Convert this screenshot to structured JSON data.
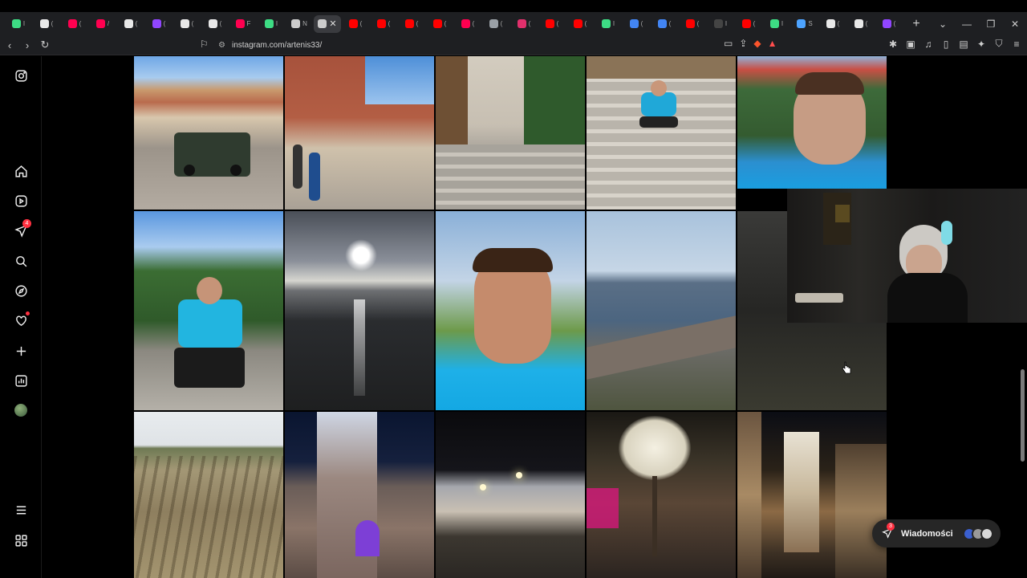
{
  "browser": {
    "tabs": [
      {
        "color": "#3ddc84",
        "letter": "I"
      },
      {
        "color": "#e8e8e8",
        "letter": "("
      },
      {
        "color": "#ff0050",
        "letter": "("
      },
      {
        "color": "#ff0050",
        "letter": "/"
      },
      {
        "color": "#e8e8e8",
        "letter": "("
      },
      {
        "color": "#9146ff",
        "letter": "("
      },
      {
        "color": "#e8e8e8",
        "letter": "("
      },
      {
        "color": "#e8e8e8",
        "letter": "("
      },
      {
        "color": "#ff0050",
        "letter": "F"
      },
      {
        "color": "#3ddc84",
        "letter": "I"
      },
      {
        "color": "#cccccc",
        "letter": "N"
      },
      {
        "color": "#cccccc",
        "letter": "(",
        "active": true
      },
      {
        "color": "#ff0000",
        "letter": "("
      },
      {
        "color": "#ff0000",
        "letter": "("
      },
      {
        "color": "#ff0000",
        "letter": "("
      },
      {
        "color": "#ff0000",
        "letter": "("
      },
      {
        "color": "#ff0050",
        "letter": "("
      },
      {
        "color": "#9aa0a6",
        "letter": "("
      },
      {
        "color": "#e1306c",
        "letter": "("
      },
      {
        "color": "#ff0000",
        "letter": "("
      },
      {
        "color": "#ff0000",
        "letter": "("
      },
      {
        "color": "#3ddc84",
        "letter": "I"
      },
      {
        "color": "#4285f4",
        "letter": "("
      },
      {
        "color": "#4285f4",
        "letter": "("
      },
      {
        "color": "#ff0000",
        "letter": "("
      },
      {
        "color": "#444444",
        "letter": "I"
      },
      {
        "color": "#ff0000",
        "letter": "("
      },
      {
        "color": "#3ddc84",
        "letter": "I"
      },
      {
        "color": "#4da3ff",
        "letter": "S"
      },
      {
        "color": "#e8e8e8",
        "letter": "("
      },
      {
        "color": "#e8e8e8",
        "letter": "("
      },
      {
        "color": "#9146ff",
        "letter": "("
      }
    ],
    "new_tab": "+",
    "url": "instagram.com/artenis33/"
  },
  "instagram": {
    "notification_count": "4",
    "messages_label": "Wiadomości",
    "messages_count": "3"
  }
}
